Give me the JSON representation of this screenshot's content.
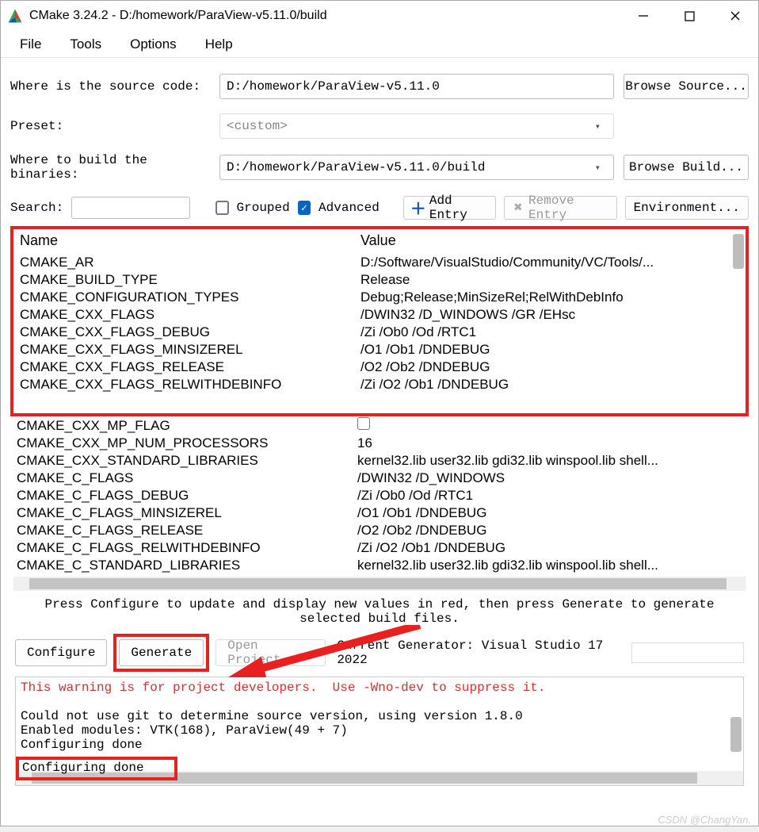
{
  "window": {
    "title": "CMake 3.24.2 - D:/homework/ParaView-v5.11.0/build"
  },
  "menu": {
    "file": "File",
    "tools": "Tools",
    "options": "Options",
    "help": "Help"
  },
  "labels": {
    "source": "Where is the source code:",
    "preset": "Preset:",
    "build": "Where to build the binaries:",
    "search": "Search:",
    "grouped": "Grouped",
    "advanced": "Advanced",
    "add": "Add Entry",
    "remove": "Remove Entry",
    "env": "Environment...",
    "browse_src": "Browse Source...",
    "browse_build": "Browse Build...",
    "preset_value": "<custom>"
  },
  "paths": {
    "source": "D:/homework/ParaView-v5.11.0",
    "build": "D:/homework/ParaView-v5.11.0/build"
  },
  "table": {
    "head_name": "Name",
    "head_value": "Value",
    "rows": [
      {
        "n": "CMAKE_AR",
        "v": "D:/Software/VisualStudio/Community/VC/Tools/...",
        "hl": true
      },
      {
        "n": "CMAKE_BUILD_TYPE",
        "v": "Release",
        "hl": true
      },
      {
        "n": "CMAKE_CONFIGURATION_TYPES",
        "v": "Debug;Release;MinSizeRel;RelWithDebInfo",
        "hl": true
      },
      {
        "n": "CMAKE_CXX_FLAGS",
        "v": "/DWIN32 /D_WINDOWS /GR /EHsc",
        "hl": true
      },
      {
        "n": "CMAKE_CXX_FLAGS_DEBUG",
        "v": "/Zi /Ob0 /Od /RTC1",
        "hl": true
      },
      {
        "n": "CMAKE_CXX_FLAGS_MINSIZEREL",
        "v": "/O1 /Ob1 /DNDEBUG",
        "hl": true
      },
      {
        "n": "CMAKE_CXX_FLAGS_RELEASE",
        "v": "/O2 /Ob2 /DNDEBUG",
        "hl": true
      },
      {
        "n": "CMAKE_CXX_FLAGS_RELWITHDEBINFO",
        "v": "/Zi /O2 /Ob1 /DNDEBUG",
        "hl": true
      },
      {
        "n": "CMAKE_CXX_MP_FLAG",
        "v": "__CHK__"
      },
      {
        "n": "CMAKE_CXX_MP_NUM_PROCESSORS",
        "v": "16"
      },
      {
        "n": "CMAKE_CXX_STANDARD_LIBRARIES",
        "v": "kernel32.lib user32.lib gdi32.lib winspool.lib shell..."
      },
      {
        "n": "CMAKE_C_FLAGS",
        "v": "/DWIN32 /D_WINDOWS"
      },
      {
        "n": "CMAKE_C_FLAGS_DEBUG",
        "v": "/Zi /Ob0 /Od /RTC1"
      },
      {
        "n": "CMAKE_C_FLAGS_MINSIZEREL",
        "v": "/O1 /Ob1 /DNDEBUG"
      },
      {
        "n": "CMAKE_C_FLAGS_RELEASE",
        "v": "/O2 /Ob2 /DNDEBUG"
      },
      {
        "n": "CMAKE_C_FLAGS_RELWITHDEBINFO",
        "v": "/Zi /O2 /Ob1 /DNDEBUG"
      },
      {
        "n": "CMAKE_C_STANDARD_LIBRARIES",
        "v": "kernel32.lib user32.lib gdi32.lib winspool.lib shell..."
      }
    ]
  },
  "instruction": "Press Configure to update and display new values in red, then press Generate to generate selected build files.",
  "actions": {
    "configure": "Configure",
    "generate": "Generate",
    "open": "Open Project",
    "gen_label": "Current Generator: Visual Studio 17 2022"
  },
  "log": {
    "warn": "This warning is for project developers.  Use -Wno-dev to suppress it.",
    "line2": "Could not use git to determine source version, using version 1.8.0",
    "line3": "Enabled modules: VTK(168), ParaView(49 + 7)",
    "done": "Configuring done"
  },
  "watermark": "CSDN @ChangYan."
}
